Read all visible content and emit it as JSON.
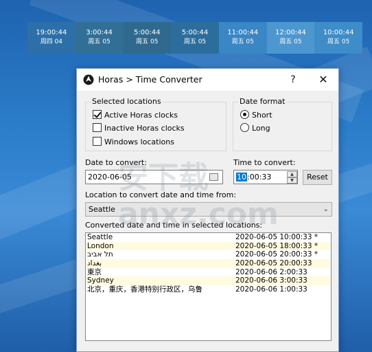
{
  "clocks": [
    {
      "time": "19:00:44",
      "date": "周四 04"
    },
    {
      "time": "3:00:44",
      "date": "周五 05"
    },
    {
      "time": "5:00:44",
      "date": "周五 05"
    },
    {
      "time": "5:00:44",
      "date": "周五 05"
    },
    {
      "time": "11:00:44",
      "date": "周五 05"
    },
    {
      "time": "12:00:44",
      "date": "周五 05"
    },
    {
      "time": "10:00:44",
      "date": "周五 05"
    }
  ],
  "clock_colors": [
    "#2d6fa8",
    "#326f97",
    "#2f6a8e",
    "#2b6d9c",
    "#3b86c4",
    "#4d97d0",
    "#3e8cc8"
  ],
  "window": {
    "title": "Horas > Time Converter",
    "help": "?",
    "close": "✕"
  },
  "selected_locations": {
    "legend": "Selected locations",
    "items": [
      {
        "label": "Active Horas clocks",
        "checked": true
      },
      {
        "label": "Inactive Horas clocks",
        "checked": false
      },
      {
        "label": "Windows locations",
        "checked": false
      }
    ]
  },
  "date_format": {
    "legend": "Date format",
    "options": [
      {
        "label": "Short",
        "selected": true
      },
      {
        "label": "Long",
        "selected": false
      }
    ]
  },
  "date_to_convert": {
    "label": "Date to convert:",
    "value": "2020-06-05"
  },
  "time_to_convert": {
    "label": "Time to convert:",
    "hour": "10",
    "rest": ":00:33"
  },
  "reset_label": "Reset",
  "location_from": {
    "label": "Location to convert date and time from:",
    "value": "Seattle"
  },
  "converted": {
    "label": "Converted date and time in selected locations:",
    "rows": [
      {
        "name": "Seattle",
        "value": "2020-06-05 10:00:33 *"
      },
      {
        "name": "London",
        "value": "2020-06-05 18:00:33 *"
      },
      {
        "name": "תל אביב",
        "value": "2020-06-05 20:00:33 *"
      },
      {
        "name": "بغداد",
        "value": "2020-06-05 20:00:33"
      },
      {
        "name": "東京",
        "value": "2020-06-06 2:00:33"
      },
      {
        "name": "Sydney",
        "value": "2020-06-06 3:00:33"
      },
      {
        "name": "北京，重庆，香港特别行政区，乌鲁",
        "value": "2020-06-06 1:00:33"
      }
    ]
  },
  "watermark": "安下载 anxz.com"
}
